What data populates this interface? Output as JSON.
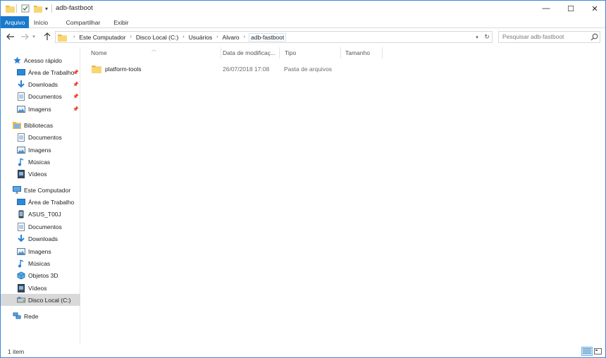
{
  "window": {
    "title": "adb-fastboot",
    "controls": {
      "minimize": "—",
      "maximize": "☐",
      "close": "✕"
    }
  },
  "ribbon": {
    "tabs": [
      {
        "label": "Arquivo",
        "active": true
      },
      {
        "label": "Início"
      },
      {
        "label": "Compartilhar"
      },
      {
        "label": "Exibir"
      }
    ]
  },
  "address": {
    "breadcrumbs": [
      "Este Computador",
      "Disco Local (C:)",
      "Usuários",
      "Alvaro",
      "adb-fastboot"
    ],
    "separator": "›"
  },
  "search": {
    "placeholder": "Pesquisar adb-fastboot"
  },
  "sidebar": {
    "quick_access": {
      "label": "Acesso rápido",
      "items": [
        {
          "label": "Área de Trabalho",
          "icon": "desktop-icon",
          "pinned": true
        },
        {
          "label": "Downloads",
          "icon": "download-icon",
          "pinned": true
        },
        {
          "label": "Documentos",
          "icon": "documents-icon",
          "pinned": true
        },
        {
          "label": "Imagens",
          "icon": "pictures-icon",
          "pinned": true
        }
      ]
    },
    "libraries": {
      "label": "Bibliotecas",
      "items": [
        {
          "label": "Documentos",
          "icon": "documents-icon"
        },
        {
          "label": "Imagens",
          "icon": "pictures-icon"
        },
        {
          "label": "Músicas",
          "icon": "music-icon"
        },
        {
          "label": "Vídeos",
          "icon": "videos-icon"
        }
      ]
    },
    "this_pc": {
      "label": "Este Computador",
      "items": [
        {
          "label": "Área de Trabalho",
          "icon": "desktop-icon"
        },
        {
          "label": "ASUS_T00J",
          "icon": "phone-icon"
        },
        {
          "label": "Documentos",
          "icon": "documents-icon"
        },
        {
          "label": "Downloads",
          "icon": "download-icon"
        },
        {
          "label": "Imagens",
          "icon": "pictures-icon"
        },
        {
          "label": "Músicas",
          "icon": "music-icon"
        },
        {
          "label": "Objetos 3D",
          "icon": "objects-3d-icon"
        },
        {
          "label": "Vídeos",
          "icon": "videos-icon"
        },
        {
          "label": "Disco Local (C:)",
          "icon": "drive-icon",
          "selected": true
        }
      ]
    },
    "network": {
      "label": "Rede",
      "icon": "network-icon"
    }
  },
  "columns": [
    "Nome",
    "Data de modificaç...",
    "Tipo",
    "Tamanho"
  ],
  "files": [
    {
      "name": "platform-tools",
      "date": "26/07/2018 17:08",
      "type": "Pasta de arquivos",
      "size": ""
    }
  ],
  "status": {
    "item_count": "1 item"
  },
  "colors": {
    "accent": "#1979ca",
    "selection": "#d9d9d9",
    "folder": "#f7d774",
    "window_border": "#3c8ad8"
  }
}
